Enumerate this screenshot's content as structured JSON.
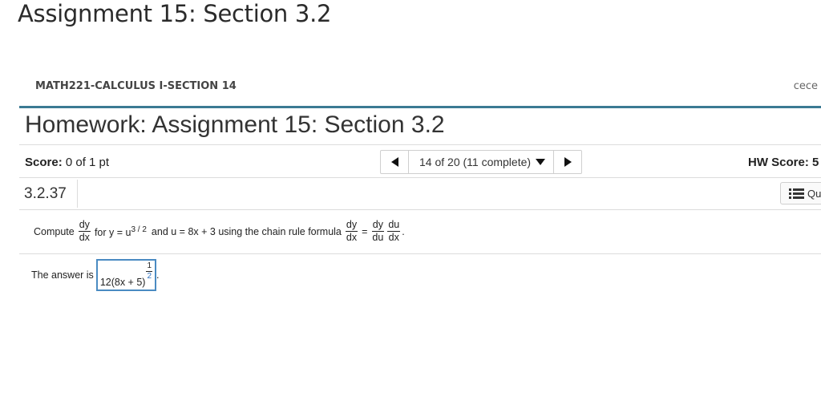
{
  "header": {
    "assignment_title": "Assignment 15: Section 3.2",
    "course": "MATH221-CALCULUS I-SECTION 14",
    "user": "cece"
  },
  "homework": {
    "title": "Homework: Assignment 15: Section 3.2",
    "score_label": "Score:",
    "score_value": "0 of 1 pt",
    "nav_label": "14 of 20 (11 complete)",
    "hw_score_label": "HW Score: 5",
    "question_number": "3.2.37",
    "question_menu_label": "Qu"
  },
  "problem": {
    "compute": "Compute",
    "dy": "dy",
    "dx": "dx",
    "for_y": "for y = u",
    "exp_y": "3 / 2",
    "and_u": "and u = 8x + 3 using the chain rule formula",
    "eq": "=",
    "du": "du",
    "period": "."
  },
  "answer": {
    "prefix": "The answer is",
    "expr": "12(8x + 5)",
    "exp_num": "1",
    "exp_den": "2",
    "suffix": "."
  },
  "icons": {
    "prev": "triangle-left-icon",
    "next": "triangle-right-icon",
    "dropdown": "triangle-down-icon",
    "question_list": "list-icon"
  },
  "colors": {
    "accent_rule": "#3b7a93",
    "input_border": "#4a8bc2"
  }
}
